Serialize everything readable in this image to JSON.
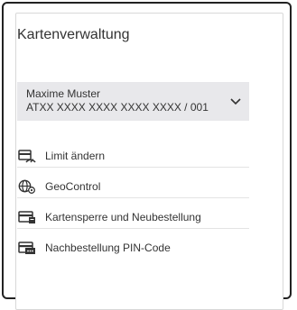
{
  "card": {
    "title": "Kartenverwaltung",
    "account": {
      "name": "Maxime Muster",
      "number": "ATXX XXXX XXXX XXXX XXXX / 001",
      "chevron_icon": "chevron-down-icon"
    },
    "menu": [
      {
        "label": "Limit ändern",
        "icon": "limit-gauge-icon"
      },
      {
        "label": "GeoControl",
        "icon": "globe-gear-icon"
      },
      {
        "label": "Kartensperre und Neubestellung",
        "icon": "card-lock-icon"
      },
      {
        "label": "Nachbestellung PIN-Code",
        "icon": "card-pin-icon"
      }
    ]
  }
}
